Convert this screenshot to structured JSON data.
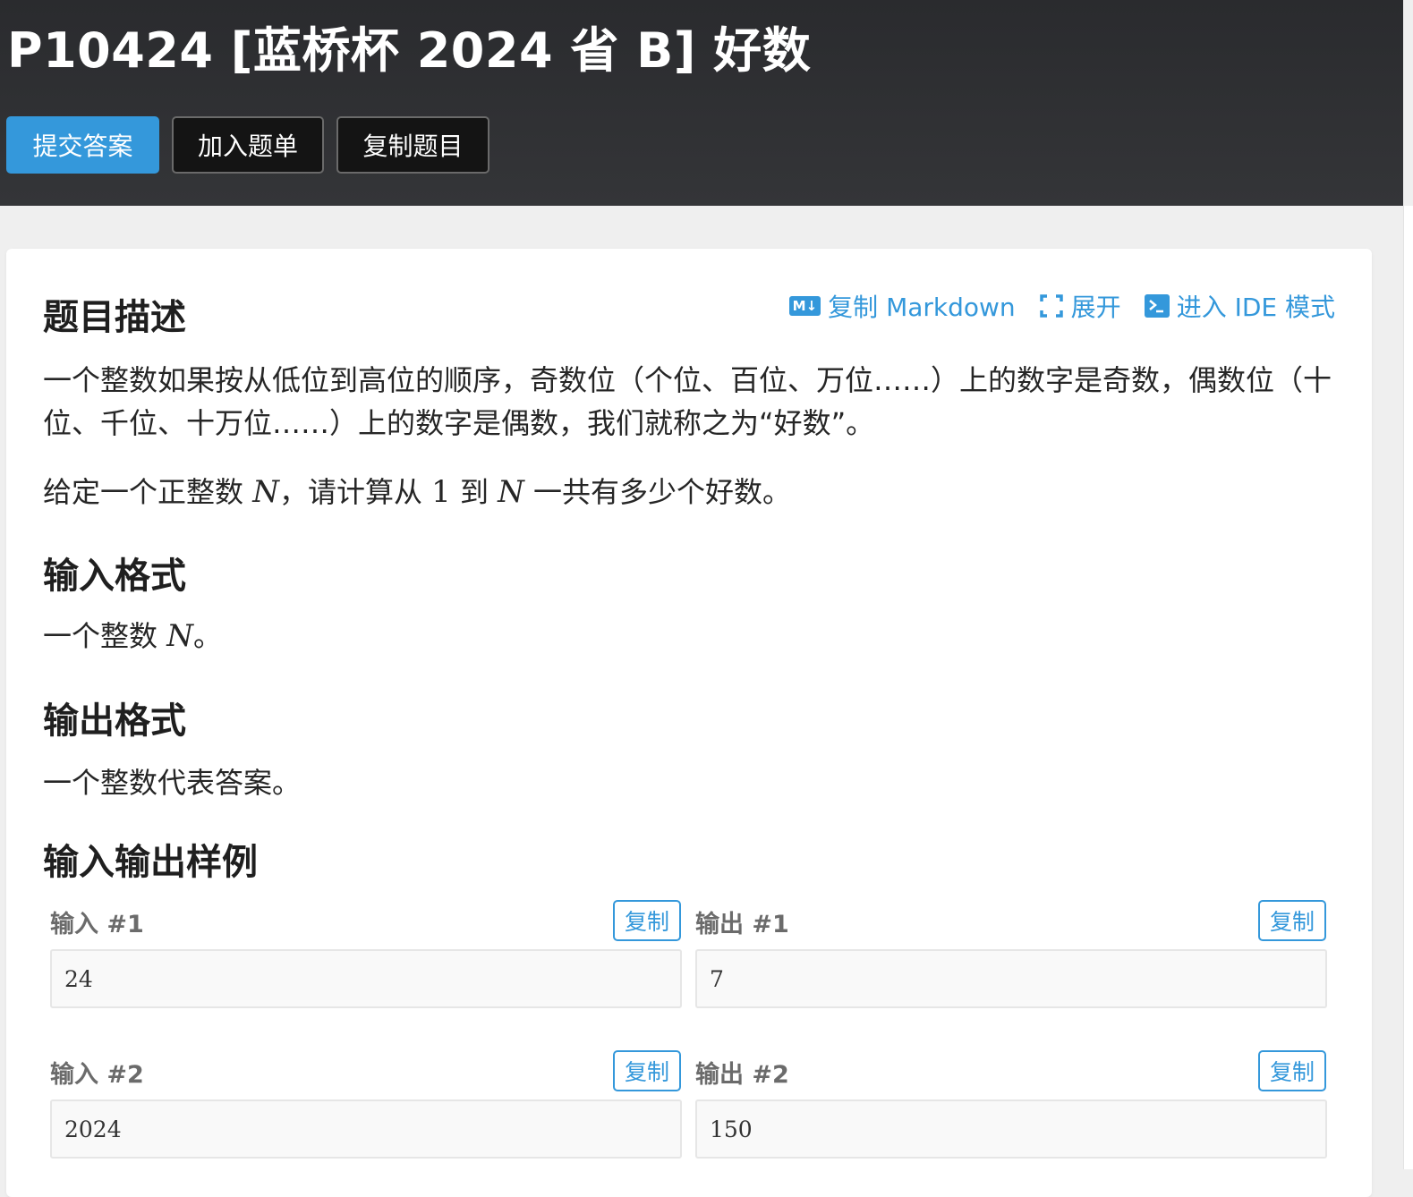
{
  "header": {
    "title": "P10424 [蓝桥杯 2024 省 B] 好数",
    "buttons": {
      "submit": "提交答案",
      "add_to_list": "加入题单",
      "copy_problem": "复制题目"
    }
  },
  "toolbar": {
    "copy_markdown": "复制 Markdown",
    "markdown_badge": "M↓",
    "expand": "展开",
    "ide_mode": "进入 IDE 模式"
  },
  "description": {
    "title": "题目描述",
    "para1": "一个整数如果按从低位到高位的顺序，奇数位（个位、百位、万位……）上的数字是奇数，偶数位（十位、千位、十万位……）上的数字是偶数，我们就称之为“好数”。",
    "para2": {
      "p1": "给定一个正整数 ",
      "m1": "N",
      "p2": "，请计算从 ",
      "m2": "1",
      "p3": " 到 ",
      "m3": "N",
      "p4": " 一共有多少个好数。"
    }
  },
  "input_format": {
    "title": "输入格式",
    "text_before": "一个整数 ",
    "math": "N",
    "text_after": "。"
  },
  "output_format": {
    "title": "输出格式",
    "text": "一个整数代表答案。"
  },
  "samples": {
    "title": "输入输出样例",
    "copy_label": "复制",
    "items": [
      {
        "input_label": "输入 #1",
        "output_label": "输出 #1",
        "input": "24",
        "output": "7"
      },
      {
        "input_label": "输入 #2",
        "output_label": "输出 #2",
        "input": "2024",
        "output": "150"
      }
    ]
  },
  "colors": {
    "header_bg": "#2d2e30",
    "primary": "#3498db",
    "page_bg": "#efefef"
  }
}
